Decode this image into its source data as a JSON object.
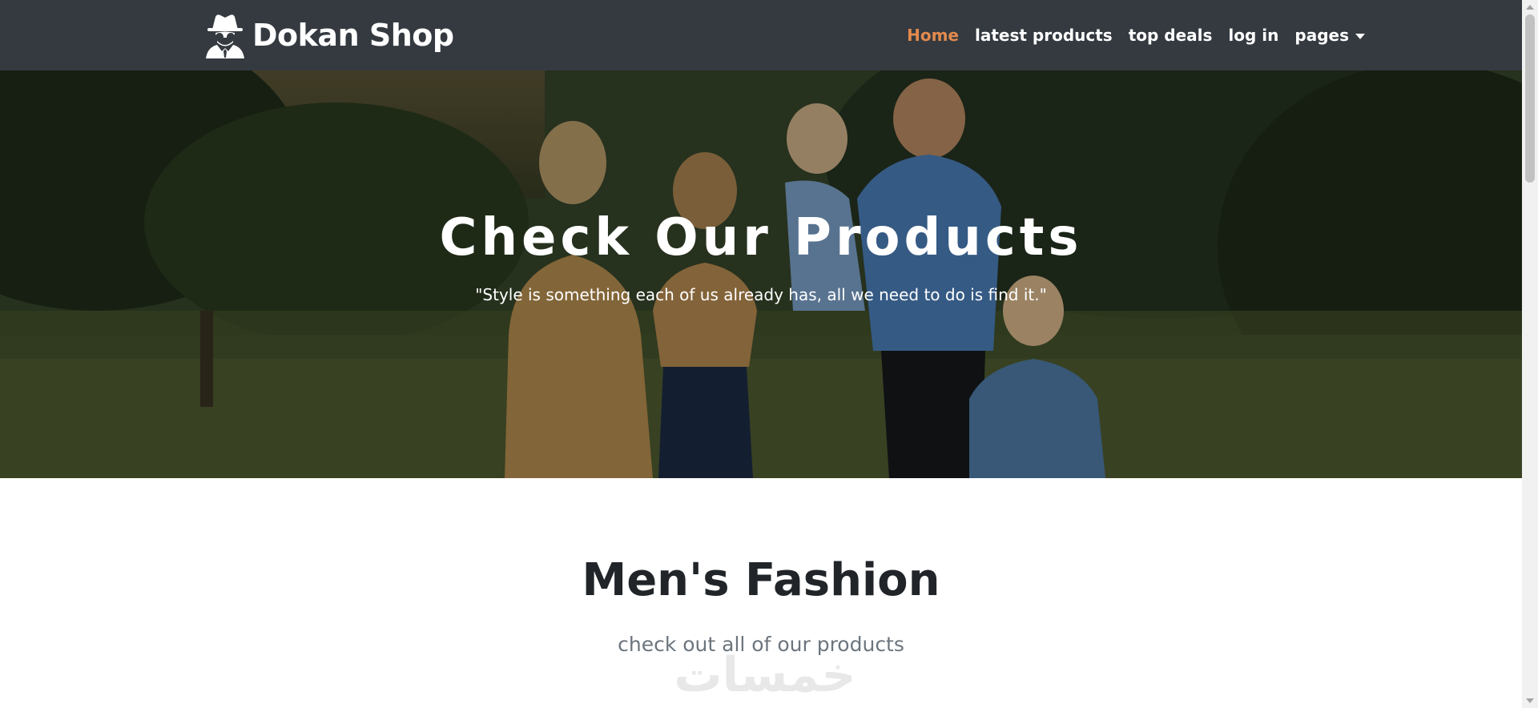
{
  "navbar": {
    "brand_icon": "spy-icon",
    "brand": "Dokan Shop",
    "links": [
      {
        "label": "Home",
        "active": true
      },
      {
        "label": "latest products",
        "active": false
      },
      {
        "label": "top deals",
        "active": false
      },
      {
        "label": "log in",
        "active": false
      }
    ],
    "dropdown_label": "pages",
    "dropdown_icon": "caret-down-icon",
    "active_color": "#e28a4d",
    "background": "#343a40"
  },
  "hero": {
    "title": "Check Our Products",
    "quote": "\"Style is something each of us already has, all we need to do is find it.\""
  },
  "section": {
    "title": "Men's Fashion",
    "subtitle": "check out all of our products"
  },
  "watermark": "خمسات"
}
